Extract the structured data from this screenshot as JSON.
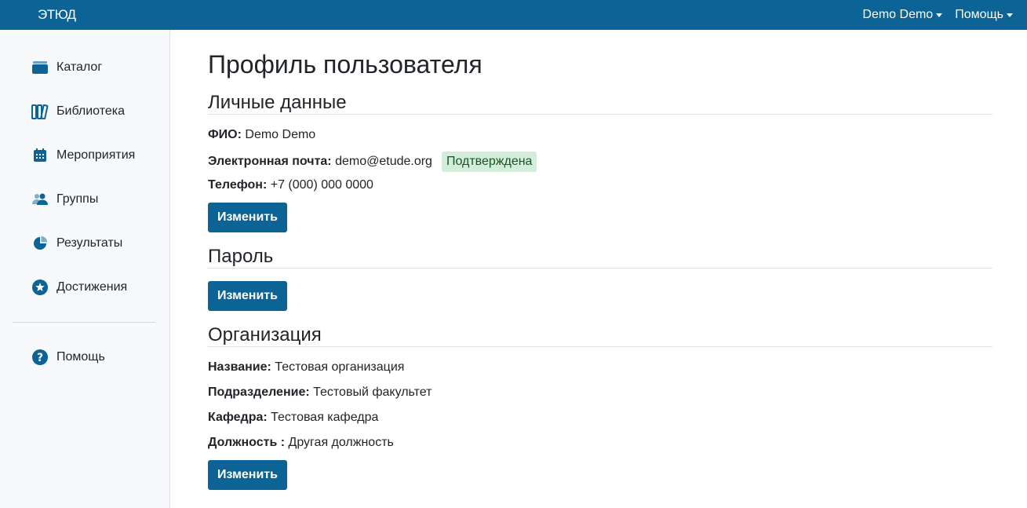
{
  "header": {
    "logo_text": "ЭТЮД",
    "user_menu_label": "Demo Demo",
    "help_menu_label": "Помощь"
  },
  "sidebar": {
    "items": [
      {
        "label": "Каталог",
        "icon": "catalog-icon"
      },
      {
        "label": "Библиотека",
        "icon": "library-icon"
      },
      {
        "label": "Мероприятия",
        "icon": "calendar-icon"
      },
      {
        "label": "Группы",
        "icon": "users-icon"
      },
      {
        "label": "Результаты",
        "icon": "pie-chart-icon"
      },
      {
        "label": "Достижения",
        "icon": "star-icon"
      }
    ],
    "help": {
      "label": "Помощь",
      "icon": "question-circle-icon"
    }
  },
  "main": {
    "title": "Профиль пользователя",
    "personal": {
      "title": "Личные данные",
      "fio_label": "ФИО:",
      "fio_value": "Demo Demo",
      "email_label": "Электронная почта:",
      "email_value": "demo@etude.org",
      "email_status": "Подтверждена",
      "phone_label": "Телефон:",
      "phone_value": "+7 (000) 000 0000",
      "edit_label": "Изменить"
    },
    "password": {
      "title": "Пароль",
      "edit_label": "Изменить"
    },
    "organization": {
      "title": "Организация",
      "name_label": "Название:",
      "name_value": "Тестовая организация",
      "division_label": "Подразделение:",
      "division_value": "Тестовый факультет",
      "department_label": "Кафедра:",
      "department_value": "Тестовая кафедра",
      "position_label": "Должность :",
      "position_value": "Другая должность",
      "edit_label": "Изменить"
    }
  },
  "colors": {
    "brand": "#0b6396",
    "badge_bg": "#d4edda",
    "badge_text": "#155724"
  }
}
